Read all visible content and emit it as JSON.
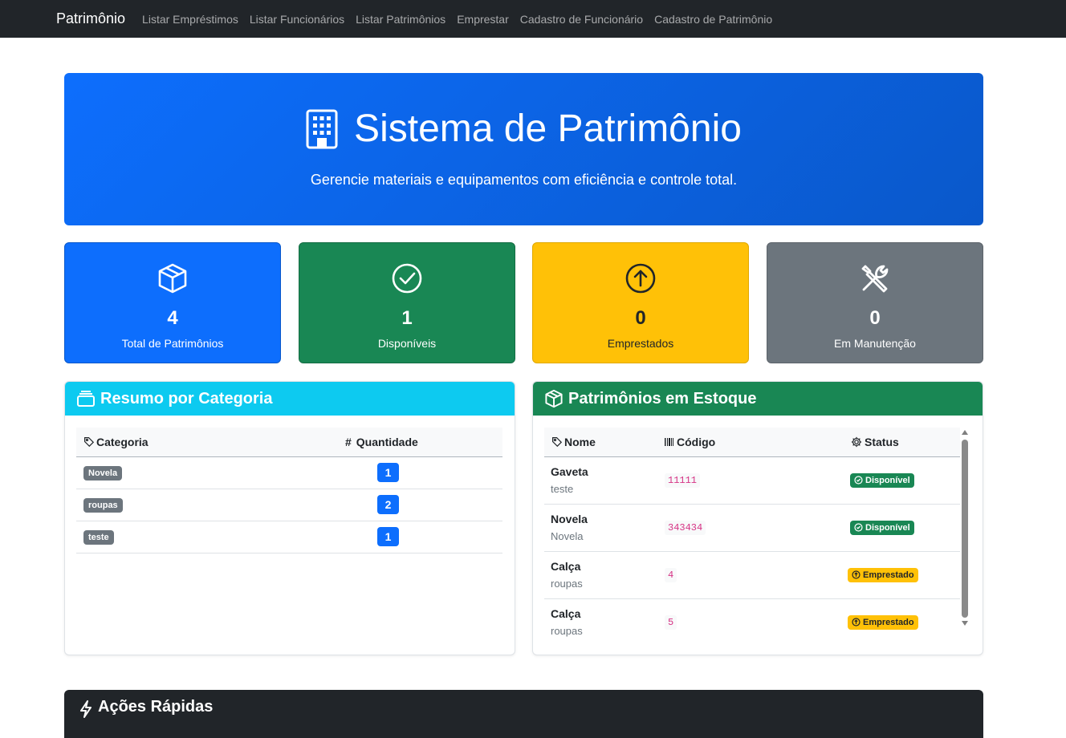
{
  "nav": {
    "brand": "Patrimônio",
    "links": [
      "Listar Empréstimos",
      "Listar Funcionários",
      "Listar Patrimônios",
      "Emprestar",
      "Cadastro de Funcionário",
      "Cadastro de Patrimônio"
    ]
  },
  "hero": {
    "title": "Sistema de Patrimônio",
    "subtitle": "Gerencie materiais e equipamentos com eficiência e controle total.",
    "icon": "building-icon"
  },
  "stats": [
    {
      "value": "4",
      "label": "Total de Patrimônios",
      "color": "#0d6efd",
      "icon": "box-icon"
    },
    {
      "value": "1",
      "label": "Disponíveis",
      "color": "#198754",
      "icon": "check-circle-icon"
    },
    {
      "value": "0",
      "label": "Emprestados",
      "color": "#ffc107",
      "icon": "arrow-up-circle-icon"
    },
    {
      "value": "0",
      "label": "Em Manutenção",
      "color": "#6c757d",
      "icon": "tools-icon"
    }
  ],
  "category_card": {
    "title": "Resumo por Categoria",
    "header_color": "#0dcaf0",
    "col_category": "Categoria",
    "col_qty_hash": "#",
    "col_qty": "Quantidade",
    "rows": [
      {
        "category": "Novela",
        "qty": "1"
      },
      {
        "category": "roupas",
        "qty": "2"
      },
      {
        "category": "teste",
        "qty": "1"
      }
    ]
  },
  "inventory_card": {
    "title": "Patrimônios em Estoque",
    "header_color": "#198754",
    "col_name": "Nome",
    "col_code": "Código",
    "col_status": "Status",
    "rows": [
      {
        "name": "Gaveta",
        "category": "teste",
        "code": "11111",
        "status": "Disponível",
        "status_type": "available"
      },
      {
        "name": "Novela",
        "category": "Novela",
        "code": "343434",
        "status": "Disponível",
        "status_type": "available"
      },
      {
        "name": "Calça",
        "category": "roupas",
        "code": "4",
        "status": "Emprestado",
        "status_type": "loaned"
      },
      {
        "name": "Calça",
        "category": "roupas",
        "code": "5",
        "status": "Emprestado",
        "status_type": "loaned"
      }
    ]
  },
  "quick_actions": {
    "title": "Ações Rápidas"
  }
}
